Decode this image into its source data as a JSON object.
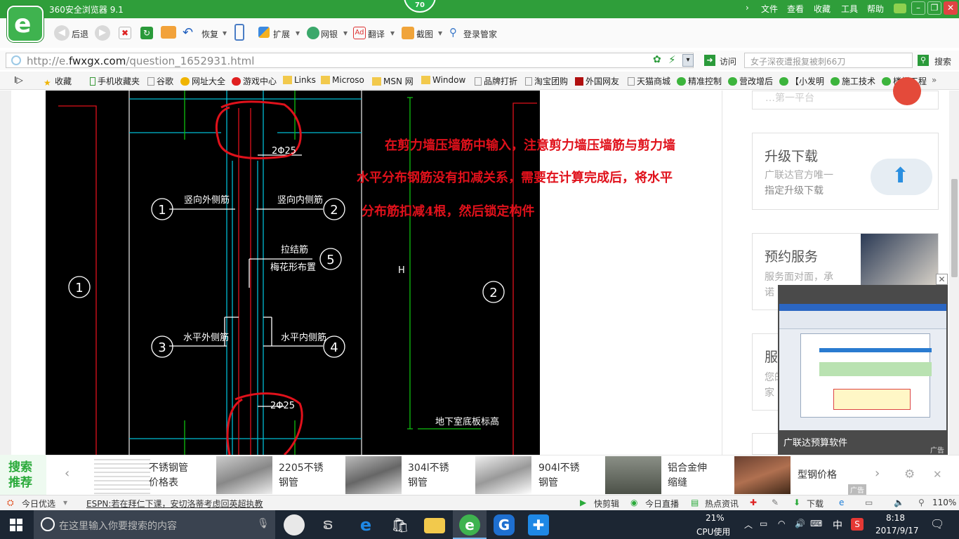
{
  "window": {
    "title": "360安全浏览器 9.1",
    "score": "70",
    "menu": [
      "文件",
      "查看",
      "收藏",
      "工具",
      "帮助"
    ]
  },
  "nav": {
    "back": "后退",
    "restore": "恢复",
    "extensions": "扩展",
    "netbank": "网银",
    "translate": "翻译",
    "screenshot": "截图",
    "login": "登录管家"
  },
  "address": {
    "url_scheme": "http://e.",
    "url_domain": "fwxgx.com",
    "url_path": "/question_1652931.html",
    "visit": "访问",
    "search_placeholder": "女子深夜遭报复被刺66刀",
    "search": "搜索"
  },
  "bookmarks": [
    "收藏",
    "手机收藏夹",
    "谷歌",
    "网址大全",
    "游戏中心",
    "Links",
    "Microso",
    "MSN 网",
    "Window",
    "品牌打折",
    "淘宝团购",
    "外国网友",
    "天猫商城",
    "精准控制",
    "营改增后",
    "【小发明",
    "施工技术",
    "楼梯工程"
  ],
  "drawing": {
    "labels": {
      "vert_outer": "竖向外侧筋",
      "vert_inner": "竖向内侧筋",
      "tie_bar": "拉结筋",
      "tie_layout": "梅花形布置",
      "horiz_outer": "水平外侧筋",
      "horiz_inner": "水平内侧筋",
      "bar_top": "2Φ25",
      "bar_bottom": "2Φ25",
      "basement": "地下室底板标高",
      "h_mark": "H"
    },
    "numbers": [
      "1",
      "2",
      "5",
      "3",
      "4",
      "1",
      "2"
    ]
  },
  "annotation": {
    "line1": "在剪力墙压墙筋中输入，注意剪力墙压墙筋与剪力墙",
    "line2": "水平分布钢筋没有扣减关系，需要在计算完成后，将水平",
    "line3": "分布筋扣减4根，然后锁定构件"
  },
  "sidebar": {
    "top_fragment": "…第一平台",
    "upgrade_title": "升级下载",
    "upgrade_sub1": "广联达官方唯一",
    "upgrade_sub2": "指定升级下载",
    "presale_title": "预约服务",
    "presale_sub1": "服务面对面，承",
    "presale_sub2": "诺",
    "service_title": "服",
    "service_sub1": "您的",
    "service_sub2": "家"
  },
  "popup_ad": {
    "caption": "广联达预算软件",
    "ad_label": "广告"
  },
  "recommend": {
    "label1": "搜索",
    "label2": "推荐",
    "ad_label": "广告",
    "items": [
      {
        "line1": "不锈钢管",
        "line2": "价格表"
      },
      {
        "line1": "2205不锈",
        "line2": "钢管"
      },
      {
        "line1": "304l不锈",
        "line2": "钢管"
      },
      {
        "line1": "904l不锈",
        "line2": "钢管"
      },
      {
        "line1": "铝合金伸",
        "line2": "缩缝"
      },
      {
        "line1": "型钢价格",
        "line2": ""
      }
    ]
  },
  "status": {
    "today": "今日优选",
    "news": "ESPN:若在拜仁下课，安切洛蒂考虑回英超执教",
    "quickclip": "快剪辑",
    "live": "今日直播",
    "hotnews": "热点资讯",
    "download": "下载",
    "zoom": "110%"
  },
  "taskbar": {
    "search_placeholder": "在这里输入你要搜索的内容",
    "cpu_pct": "21%",
    "cpu_label": "CPU使用",
    "ime": "中",
    "time": "8:18",
    "date": "2017/9/17"
  },
  "colors": {
    "title_green": "#2f9e3a",
    "annotation_red": "#e0111b",
    "cad_bg": "#000000",
    "cad_cyan": "#00bcd4",
    "cad_green": "#10c010",
    "cad_red": "#e0111b"
  }
}
